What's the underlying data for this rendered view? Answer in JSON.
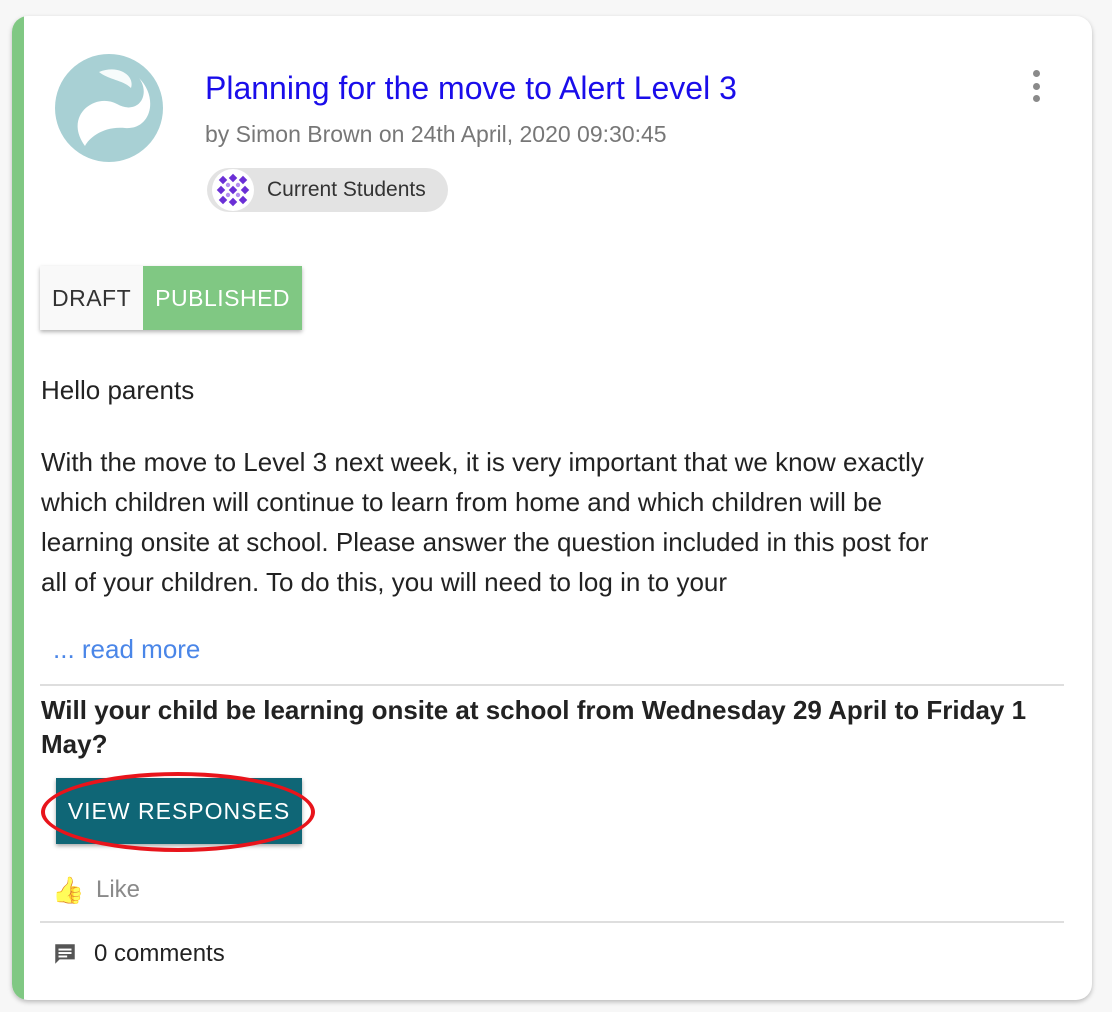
{
  "post": {
    "title": "Planning for the move to Alert Level 3",
    "byline": "by Simon Brown on 24th April, 2020 09:30:45",
    "audience_chip": "Current Students",
    "status_toggle": {
      "draft": "DRAFT",
      "published": "PUBLISHED",
      "selected": "PUBLISHED"
    },
    "greeting": "Hello parents",
    "body_lines": [
      "With the move to Level 3 next week, it is very important that we know exactly",
      "which children will continue to learn from home and which children will be",
      "learning onsite at school. Please answer the question included in this post for",
      "all of your children. To do this, you will need to log in to your"
    ],
    "read_more": "... read more",
    "question": "Will your child be learning onsite at school from Wednesday 29 April to Friday 1 May?",
    "view_responses": "VIEW RESPONSES",
    "like_label": "Like",
    "comments_label": "0 comments"
  },
  "icons": {
    "avatar": "school-logo-icon",
    "menu": "more-vertical-icon",
    "chip": "group-pattern-icon",
    "like": "thumbs-up-icon",
    "comments": "comment-icon"
  },
  "colors": {
    "title_link": "#1a0dea",
    "accent_green": "#80c883",
    "view_button": "#0f6676",
    "read_more": "#4a86e8",
    "annotation_red": "#e8141b",
    "avatar_bg": "#a8d0d4"
  }
}
